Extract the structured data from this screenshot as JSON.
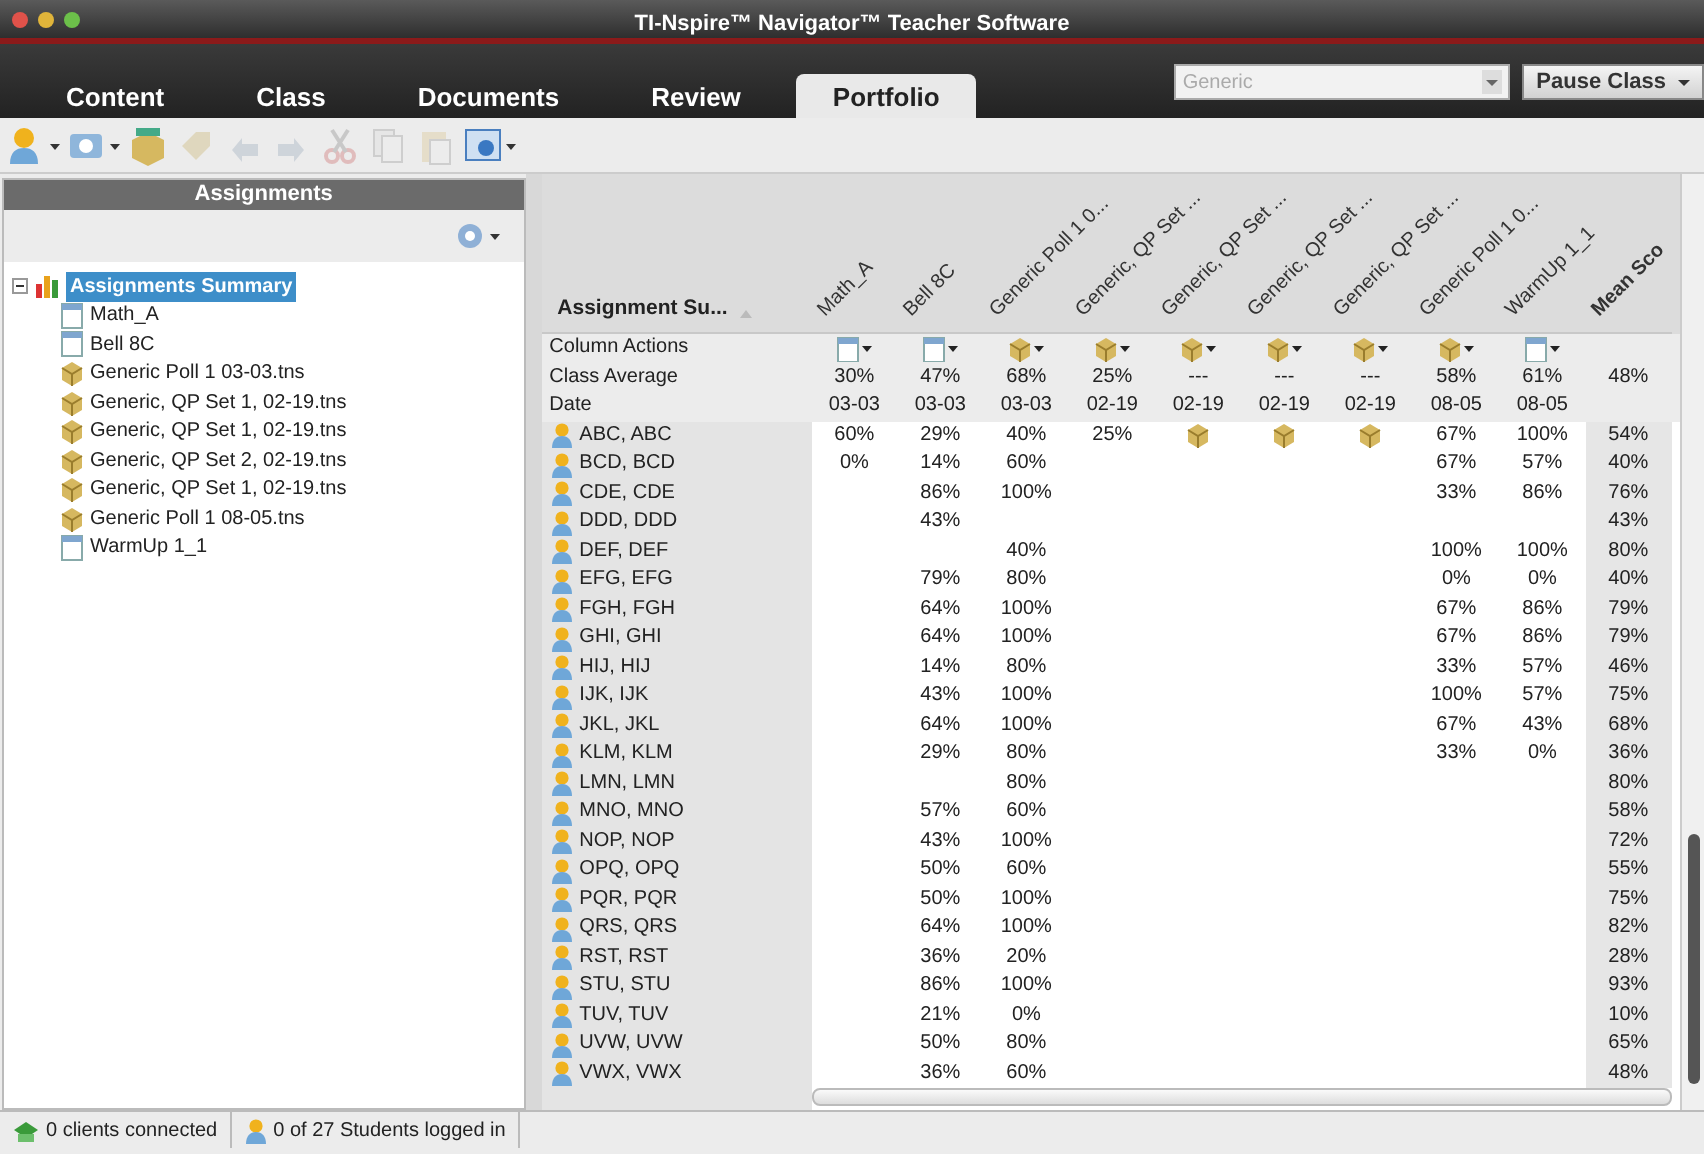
{
  "window": {
    "title": "TI-Nspire™ Navigator™ Teacher Software"
  },
  "tabs": [
    {
      "label": "Content",
      "selected": false
    },
    {
      "label": "Class",
      "selected": false
    },
    {
      "label": "Documents",
      "selected": false
    },
    {
      "label": "Review",
      "selected": false
    },
    {
      "label": "Portfolio",
      "selected": true
    }
  ],
  "class_selector": {
    "value": "Generic",
    "disabled": true
  },
  "pause_button": {
    "label": "Pause Class"
  },
  "toolbar": [
    {
      "kind": "user",
      "disabled": false,
      "dropdown": true
    },
    {
      "kind": "screen",
      "disabled": false,
      "dropdown": true
    },
    {
      "kind": "box",
      "disabled": false,
      "dropdown": false
    },
    {
      "kind": "tag",
      "disabled": true,
      "dropdown": false
    },
    {
      "kind": "undo",
      "disabled": true,
      "dropdown": false
    },
    {
      "kind": "redo",
      "disabled": true,
      "dropdown": false
    },
    {
      "kind": "cut",
      "disabled": true,
      "dropdown": false
    },
    {
      "kind": "copy",
      "disabled": true,
      "dropdown": false
    },
    {
      "kind": "paste",
      "disabled": true,
      "dropdown": false
    },
    {
      "kind": "capture",
      "disabled": false,
      "dropdown": true
    }
  ],
  "assignments_panel": {
    "title": "Assignments",
    "tree": {
      "label": "Assignments Summary",
      "kind": "summary",
      "expanded": true,
      "selected": true,
      "children": [
        {
          "label": "Math_A",
          "kind": "document",
          "selected": false
        },
        {
          "label": "Bell 8C",
          "kind": "document",
          "selected": false
        },
        {
          "label": "Generic Poll 1 03-03.tns",
          "kind": "poll",
          "selected": false
        },
        {
          "label": "Generic, QP Set 1, 02-19.tns",
          "kind": "poll",
          "selected": false
        },
        {
          "label": "Generic, QP Set 1, 02-19.tns",
          "kind": "poll",
          "selected": false
        },
        {
          "label": "Generic, QP Set 2, 02-19.tns",
          "kind": "poll",
          "selected": false
        },
        {
          "label": "Generic, QP Set 1, 02-19.tns",
          "kind": "poll",
          "selected": false
        },
        {
          "label": "Generic Poll 1 08-05.tns",
          "kind": "poll",
          "selected": false
        },
        {
          "label": "WarmUp 1_1",
          "kind": "document",
          "selected": false
        }
      ]
    }
  },
  "table": {
    "corner_header": "Assignment Su...",
    "columns": [
      {
        "label": "Math_A",
        "kind": "document"
      },
      {
        "label": "Bell 8C",
        "kind": "document"
      },
      {
        "label": "Generic Poll 1 0...",
        "kind": "poll"
      },
      {
        "label": "Generic, QP Set ...",
        "kind": "poll"
      },
      {
        "label": "Generic, QP Set ...",
        "kind": "poll"
      },
      {
        "label": "Generic, QP Set ...",
        "kind": "poll"
      },
      {
        "label": "Generic, QP Set ...",
        "kind": "poll"
      },
      {
        "label": "Generic Poll 1 0...",
        "kind": "poll"
      },
      {
        "label": "WarmUp 1_1",
        "kind": "document"
      }
    ],
    "mean_header": "Mean Sco",
    "column_actions_label": "Column Actions",
    "class_average": {
      "label": "Class Average",
      "values": [
        "30%",
        "47%",
        "68%",
        "25%",
        "---",
        "---",
        "---",
        "58%",
        "61%"
      ],
      "mean": "48%"
    },
    "date": {
      "label": "Date",
      "values": [
        "03-03",
        "03-03",
        "03-03",
        "02-19",
        "02-19",
        "02-19",
        "02-19",
        "08-05",
        "08-05"
      ]
    },
    "students": [
      {
        "name": "ABC, ABC",
        "scores": [
          "60%",
          "29%",
          "40%",
          "25%",
          {
            "kind": "poll"
          },
          {
            "kind": "poll"
          },
          {
            "kind": "poll"
          },
          "67%",
          "100%"
        ],
        "mean": "54%"
      },
      {
        "name": "BCD, BCD",
        "scores": [
          "0%",
          "14%",
          "60%",
          {
            "kind": "blank"
          },
          {
            "kind": "blank"
          },
          {
            "kind": "blank"
          },
          {
            "kind": "blank"
          },
          "67%",
          "57%"
        ],
        "mean": "40%"
      },
      {
        "name": "CDE, CDE",
        "scores": [
          {
            "kind": "blank"
          },
          "86%",
          "100%",
          {
            "kind": "blank"
          },
          {
            "kind": "blank"
          },
          {
            "kind": "blank"
          },
          {
            "kind": "blank"
          },
          "33%",
          "86%"
        ],
        "mean": "76%"
      },
      {
        "name": "DDD, DDD",
        "scores": [
          {
            "kind": "blank"
          },
          "43%"
        ],
        "mean": "43%"
      },
      {
        "name": "DEF, DEF",
        "scores": [
          {
            "kind": "blank"
          },
          {
            "kind": "blank"
          },
          "40%",
          {
            "kind": "blank"
          },
          {
            "kind": "blank"
          },
          {
            "kind": "blank"
          },
          {
            "kind": "blank"
          },
          "100%",
          "100%"
        ],
        "mean": "80%"
      },
      {
        "name": "EFG, EFG",
        "scores": [
          {
            "kind": "blank"
          },
          "79%",
          "80%",
          {
            "kind": "blank"
          },
          {
            "kind": "blank"
          },
          {
            "kind": "blank"
          },
          {
            "kind": "blank"
          },
          "0%",
          "0%"
        ],
        "mean": "40%"
      },
      {
        "name": "FGH, FGH",
        "scores": [
          {
            "kind": "blank"
          },
          "64%",
          "100%",
          {
            "kind": "blank"
          },
          {
            "kind": "blank"
          },
          {
            "kind": "blank"
          },
          {
            "kind": "blank"
          },
          "67%",
          "86%"
        ],
        "mean": "79%"
      },
      {
        "name": "GHI, GHI",
        "scores": [
          {
            "kind": "blank"
          },
          "64%",
          "100%",
          {
            "kind": "blank"
          },
          {
            "kind": "blank"
          },
          {
            "kind": "blank"
          },
          {
            "kind": "blank"
          },
          "67%",
          "86%"
        ],
        "mean": "79%"
      },
      {
        "name": "HIJ, HIJ",
        "scores": [
          {
            "kind": "blank"
          },
          "14%",
          "80%",
          {
            "kind": "blank"
          },
          {
            "kind": "blank"
          },
          {
            "kind": "blank"
          },
          {
            "kind": "blank"
          },
          "33%",
          "57%"
        ],
        "mean": "46%"
      },
      {
        "name": "IJK, IJK",
        "scores": [
          {
            "kind": "blank"
          },
          "43%",
          "100%",
          {
            "kind": "blank"
          },
          {
            "kind": "blank"
          },
          {
            "kind": "blank"
          },
          {
            "kind": "blank"
          },
          "100%",
          "57%"
        ],
        "mean": "75%"
      },
      {
        "name": "JKL, JKL",
        "scores": [
          {
            "kind": "blank"
          },
          "64%",
          "100%",
          {
            "kind": "blank"
          },
          {
            "kind": "blank"
          },
          {
            "kind": "blank"
          },
          {
            "kind": "blank"
          },
          "67%",
          "43%"
        ],
        "mean": "68%"
      },
      {
        "name": "KLM, KLM",
        "scores": [
          {
            "kind": "blank"
          },
          "29%",
          "80%",
          {
            "kind": "blank"
          },
          {
            "kind": "blank"
          },
          {
            "kind": "blank"
          },
          {
            "kind": "blank"
          },
          "33%",
          "0%"
        ],
        "mean": "36%"
      },
      {
        "name": "LMN, LMN",
        "scores": [
          {
            "kind": "blank"
          },
          {
            "kind": "blank"
          },
          "80%"
        ],
        "mean": "80%"
      },
      {
        "name": "MNO, MNO",
        "scores": [
          {
            "kind": "blank"
          },
          "57%",
          "60%"
        ],
        "mean": "58%"
      },
      {
        "name": "NOP, NOP",
        "scores": [
          {
            "kind": "blank"
          },
          "43%",
          "100%"
        ],
        "mean": "72%"
      },
      {
        "name": "OPQ, OPQ",
        "scores": [
          {
            "kind": "blank"
          },
          "50%",
          "60%"
        ],
        "mean": "55%"
      },
      {
        "name": "PQR, PQR",
        "scores": [
          {
            "kind": "blank"
          },
          "50%",
          "100%"
        ],
        "mean": "75%"
      },
      {
        "name": "QRS, QRS",
        "scores": [
          {
            "kind": "blank"
          },
          "64%",
          "100%"
        ],
        "mean": "82%"
      },
      {
        "name": "RST, RST",
        "scores": [
          {
            "kind": "blank"
          },
          "36%",
          "20%"
        ],
        "mean": "28%"
      },
      {
        "name": "STU, STU",
        "scores": [
          {
            "kind": "blank"
          },
          "86%",
          "100%"
        ],
        "mean": "93%"
      },
      {
        "name": "TUV, TUV",
        "scores": [
          {
            "kind": "blank"
          },
          "21%",
          "0%"
        ],
        "mean": "10%"
      },
      {
        "name": "UVW, UVW",
        "scores": [
          {
            "kind": "blank"
          },
          "50%",
          "80%"
        ],
        "mean": "65%"
      },
      {
        "name": "VWX, VWX",
        "scores": [
          {
            "kind": "blank"
          },
          "36%",
          "60%"
        ],
        "mean": "48%"
      }
    ]
  },
  "status_bar": {
    "clients": "0 clients connected",
    "students": "0 of 27 Students logged in"
  }
}
